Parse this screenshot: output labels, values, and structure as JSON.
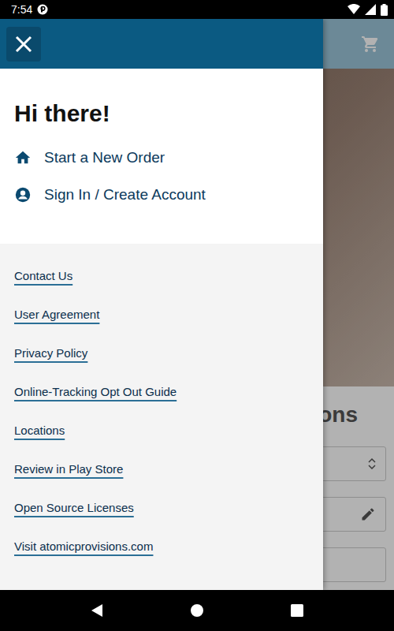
{
  "status_bar": {
    "time": "7:54"
  },
  "drawer": {
    "greeting": "Hi there!",
    "actions": [
      {
        "label": "Start a New Order",
        "kind": "order"
      },
      {
        "label": "Sign In / Create Account",
        "kind": "account"
      }
    ],
    "links": [
      {
        "label": "Contact Us"
      },
      {
        "label": "User Agreement"
      },
      {
        "label": "Privacy Policy"
      },
      {
        "label": "Online-Tracking Opt Out Guide"
      },
      {
        "label": "Locations"
      },
      {
        "label": "Review in Play Store"
      },
      {
        "label": "Open Source Licenses"
      },
      {
        "label": "Visit atomicprovisions.com"
      }
    ]
  },
  "background": {
    "title": "ions"
  }
}
